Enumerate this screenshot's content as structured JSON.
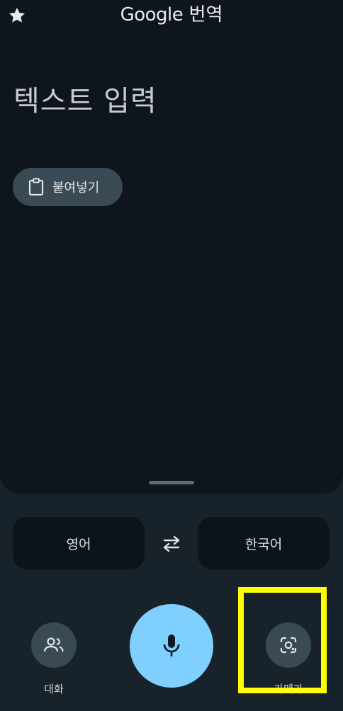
{
  "header": {
    "logo_text": "Google",
    "title_suffix": "번역",
    "favorite_icon": "star-icon"
  },
  "input": {
    "placeholder": "텍스트 입력"
  },
  "paste": {
    "label": "붙여넣기",
    "icon": "clipboard-icon"
  },
  "languages": {
    "source": "영어",
    "target": "한국어",
    "swap_icon": "swap-arrows-icon"
  },
  "bottom": {
    "conversation_label": "대화",
    "conversation_icon": "people-icon",
    "mic_icon": "microphone-icon",
    "camera_label": "카메라",
    "camera_icon": "lens-camera-icon"
  },
  "colors": {
    "background": "#17222a",
    "panel": "#0e151c",
    "mic_accent": "#7fcfff",
    "highlight": "#ffff00"
  }
}
